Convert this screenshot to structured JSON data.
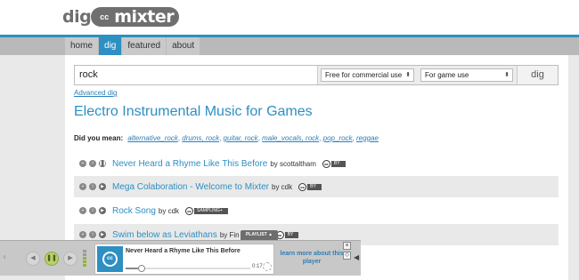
{
  "logo": {
    "left": "dig",
    "cc": "cc",
    "right": "mixter"
  },
  "nav": {
    "tabs": [
      "home",
      "dig",
      "featured",
      "about"
    ],
    "active": "dig"
  },
  "search": {
    "value": "rock",
    "license_filter": "Free for commercial use",
    "use_filter": "For game use",
    "button": "dig"
  },
  "advanced_link": "Advanced dig",
  "heading": "Electro Instrumental Music for Games",
  "did_you_mean": {
    "label": "Did you mean:",
    "items": [
      "alternative_rock",
      "drums, rock",
      "guitar, rock",
      "male_vocals, rock",
      "pop_rock",
      "reggae"
    ]
  },
  "results": [
    {
      "title": "Never Heard a Rhyme Like This Before",
      "by": "by scottaltham",
      "license_badge": "BY",
      "shaded": false
    },
    {
      "title": "Mega Colaboration - Welcome to Mixter",
      "by": "by cdk",
      "license_badge": "BY",
      "shaded": true
    },
    {
      "title": "Rock Song",
      "by": "by cdk",
      "license_badge": "SAMPLING+",
      "shaded": false
    },
    {
      "title": "Swim below as Leviathans",
      "by": "by Fin",
      "by_tail": "s",
      "license_badge": "BY",
      "shaded": true
    }
  ],
  "player": {
    "playlist_label": "PLAYLIST ▲",
    "now_playing": "Never Heard a Rhyme Like This Before",
    "time": "0:17",
    "progress": 0.1,
    "learn_more": "learn more about this player",
    "close": "×",
    "expand": "◇"
  },
  "colors": {
    "accent": "#2e8fc3",
    "header_line": "#2e8fc3",
    "play_button": "#b7d06a"
  }
}
